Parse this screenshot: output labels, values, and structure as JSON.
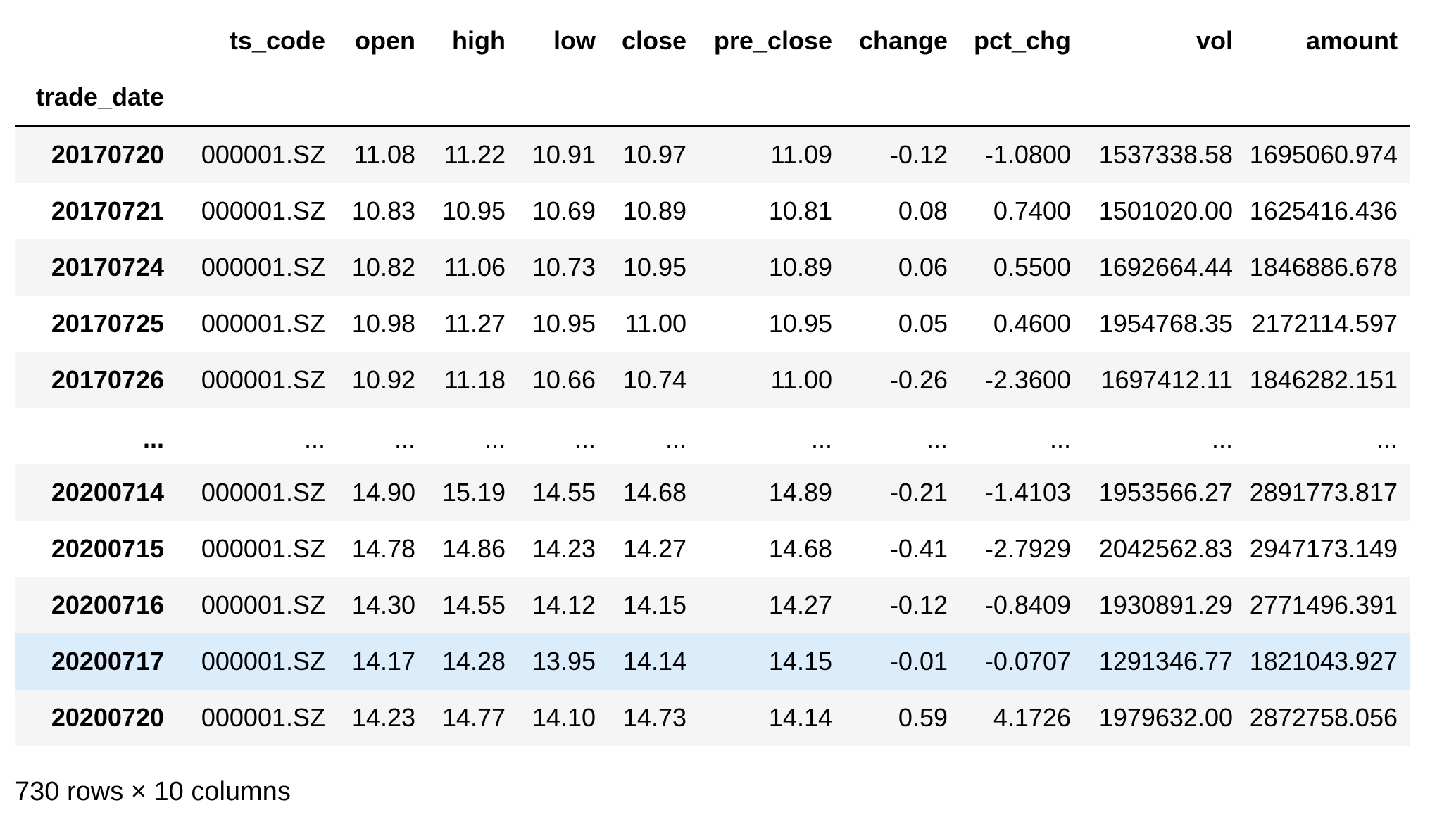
{
  "table": {
    "index_name": "trade_date",
    "columns": [
      "ts_code",
      "open",
      "high",
      "low",
      "close",
      "pre_close",
      "change",
      "pct_chg",
      "vol",
      "amount"
    ],
    "rows": [
      {
        "index": "20170720",
        "cells": [
          "000001.SZ",
          "11.08",
          "11.22",
          "10.91",
          "10.97",
          "11.09",
          "-0.12",
          "-1.0800",
          "1537338.58",
          "1695060.974"
        ]
      },
      {
        "index": "20170721",
        "cells": [
          "000001.SZ",
          "10.83",
          "10.95",
          "10.69",
          "10.89",
          "10.81",
          "0.08",
          "0.7400",
          "1501020.00",
          "1625416.436"
        ]
      },
      {
        "index": "20170724",
        "cells": [
          "000001.SZ",
          "10.82",
          "11.06",
          "10.73",
          "10.95",
          "10.89",
          "0.06",
          "0.5500",
          "1692664.44",
          "1846886.678"
        ]
      },
      {
        "index": "20170725",
        "cells": [
          "000001.SZ",
          "10.98",
          "11.27",
          "10.95",
          "11.00",
          "10.95",
          "0.05",
          "0.4600",
          "1954768.35",
          "2172114.597"
        ]
      },
      {
        "index": "20170726",
        "cells": [
          "000001.SZ",
          "10.92",
          "11.18",
          "10.66",
          "10.74",
          "11.00",
          "-0.26",
          "-2.3600",
          "1697412.11",
          "1846282.151"
        ]
      },
      {
        "index": "...",
        "cells": [
          "...",
          "...",
          "...",
          "...",
          "...",
          "...",
          "...",
          "...",
          "...",
          "..."
        ]
      },
      {
        "index": "20200714",
        "cells": [
          "000001.SZ",
          "14.90",
          "15.19",
          "14.55",
          "14.68",
          "14.89",
          "-0.21",
          "-1.4103",
          "1953566.27",
          "2891773.817"
        ]
      },
      {
        "index": "20200715",
        "cells": [
          "000001.SZ",
          "14.78",
          "14.86",
          "14.23",
          "14.27",
          "14.68",
          "-0.41",
          "-2.7929",
          "2042562.83",
          "2947173.149"
        ]
      },
      {
        "index": "20200716",
        "cells": [
          "000001.SZ",
          "14.30",
          "14.55",
          "14.12",
          "14.15",
          "14.27",
          "-0.12",
          "-0.8409",
          "1930891.29",
          "2771496.391"
        ]
      },
      {
        "index": "20200717",
        "cells": [
          "000001.SZ",
          "14.17",
          "14.28",
          "13.95",
          "14.14",
          "14.15",
          "-0.01",
          "-0.0707",
          "1291346.77",
          "1821043.927"
        ]
      },
      {
        "index": "20200720",
        "cells": [
          "000001.SZ",
          "14.23",
          "14.77",
          "14.10",
          "14.73",
          "14.14",
          "0.59",
          "4.1726",
          "1979632.00",
          "2872758.056"
        ]
      }
    ]
  },
  "colors": {
    "row_odd": "#f5f5f5",
    "row_even": "#ffffff",
    "row_hover": "#dbecfa",
    "header_rule": "#000000"
  },
  "footer": {
    "shape": "730 rows × 10 columns"
  }
}
